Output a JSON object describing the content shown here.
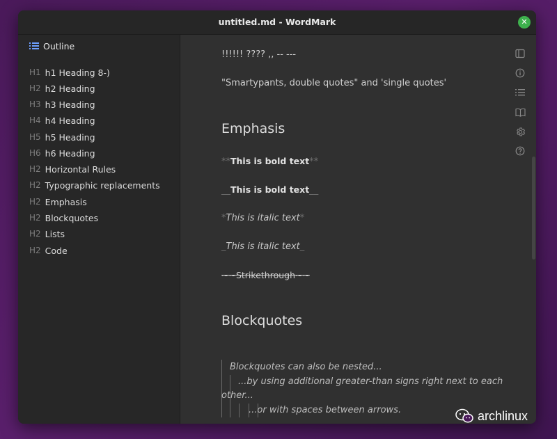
{
  "window": {
    "title": "untitled.md - WordMark",
    "close_glyph": "✕"
  },
  "sidebar": {
    "header": "Outline",
    "items": [
      {
        "level": "H1",
        "label": "h1 Heading 8-)"
      },
      {
        "level": "H2",
        "label": "h2 Heading"
      },
      {
        "level": "H3",
        "label": "h3 Heading"
      },
      {
        "level": "H4",
        "label": "h4 Heading"
      },
      {
        "level": "H5",
        "label": "h5 Heading"
      },
      {
        "level": "H6",
        "label": "h6 Heading"
      },
      {
        "level": "H2",
        "label": "Horizontal Rules"
      },
      {
        "level": "H2",
        "label": "Typographic replacements"
      },
      {
        "level": "H2",
        "label": "Emphasis"
      },
      {
        "level": "H2",
        "label": "Blockquotes"
      },
      {
        "level": "H2",
        "label": "Lists"
      },
      {
        "level": "H2",
        "label": "Code"
      }
    ]
  },
  "editor": {
    "line_punct": "!!!!!! ???? ,,  -- ---",
    "line_quotes": "\"Smartypants, double quotes\" and 'single quotes'",
    "heading_emphasis": "Emphasis",
    "bold_star_marker": "**",
    "bold_text": "This is bold text",
    "bold_us_marker": "__",
    "italic_star_marker": "*",
    "italic_text": "This is italic text",
    "italic_us_marker": "_",
    "strike_marker": "~~",
    "strike_text": "Strikethrough",
    "heading_blockquotes": "Blockquotes",
    "bq_line1": "Blockquotes can also be nested...",
    "bq_line2": "...by using additional greater-than signs right next to each",
    "bq_line3": "other...",
    "bq_line4": "...or with spaces between arrows."
  },
  "toolbar_icons": [
    "sidebar-toggle-icon",
    "info-icon",
    "list-icon",
    "book-icon",
    "gear-icon",
    "help-icon"
  ],
  "watermark": {
    "text": "archlinux"
  },
  "colors": {
    "close_button": "#3eb14d",
    "background": "#4a1a5a"
  }
}
